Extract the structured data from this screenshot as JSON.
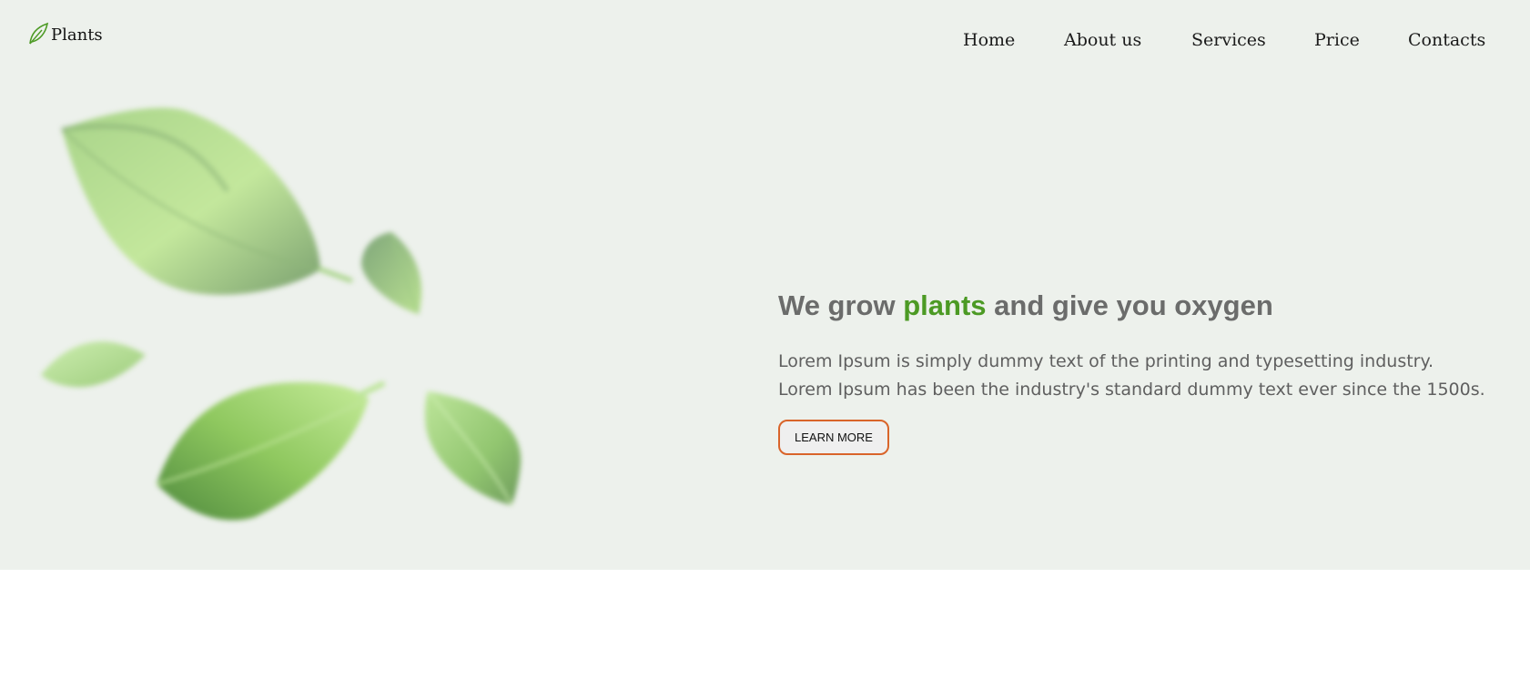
{
  "brand": {
    "name": "Plants",
    "icon": "leaf-icon",
    "accent_color": "#4c9a24"
  },
  "nav": {
    "items": [
      {
        "label": "Home"
      },
      {
        "label": "About us"
      },
      {
        "label": "Services"
      },
      {
        "label": "Price"
      },
      {
        "label": "Contacts"
      }
    ]
  },
  "hero": {
    "headline_prefix": "We grow",
    "headline_accent": "plants",
    "headline_suffix": "and give you oxygen",
    "description_line1": "Lorem Ipsum is simply dummy text of the printing and typesetting industry.",
    "description_line2": "Lorem Ipsum has been the industry's standard dummy text ever since the 1500s.",
    "button_label": "LEARN MORE",
    "button_border_color": "#d9642a",
    "background_color": "#edf1ec"
  }
}
